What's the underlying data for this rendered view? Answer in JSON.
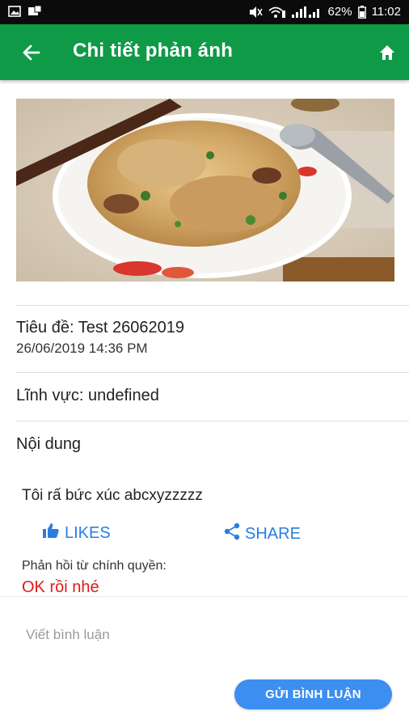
{
  "status_bar": {
    "battery_percent": "62%",
    "time": "11:02",
    "icons": [
      "gallery-icon",
      "notification-icon",
      "mute-icon",
      "wifi-icon",
      "signal-icon",
      "battery-icon"
    ]
  },
  "app_bar": {
    "title": "Chi tiết phản ánh",
    "back_icon": "arrow-left-icon",
    "home_icon": "home-icon",
    "color": "#0f9a48"
  },
  "report": {
    "title": "Tiêu đề: Test 26062019",
    "datetime": "26/06/2019 14:36 PM",
    "field": "Lĩnh vực: undefined",
    "content_label": "Nội dung",
    "content": "Tôi rấ bức xúc abcxyzzzzz"
  },
  "actions": {
    "like_label": "LIKES",
    "share_label": "SHARE",
    "color": "#2a7de1"
  },
  "response": {
    "label": "Phản hồi từ chính quyền:",
    "text": "OK rồi nhé",
    "color": "#e01b1b"
  },
  "comment": {
    "placeholder": "Viết bình luận",
    "send_label": "GỬI BÌNH LUẬN",
    "button_color": "#3d8ef1"
  }
}
